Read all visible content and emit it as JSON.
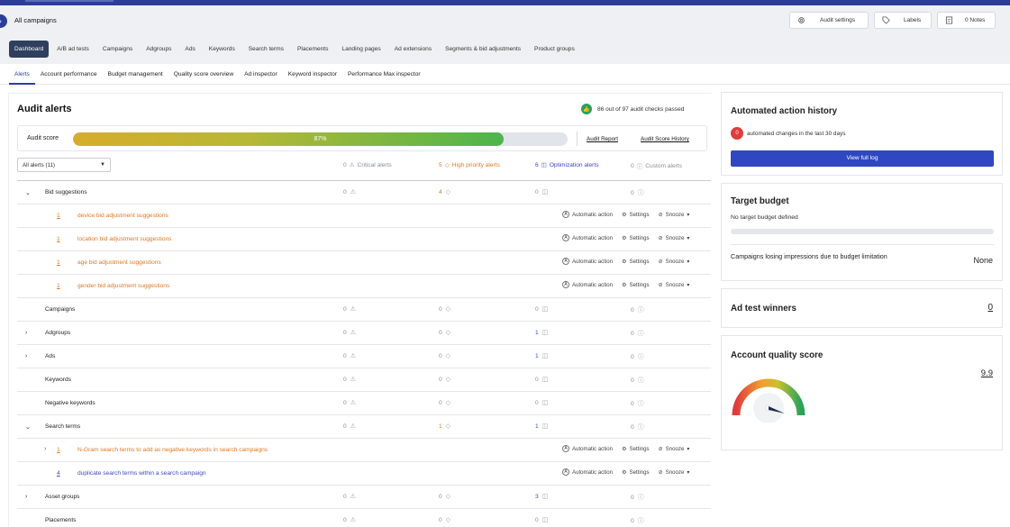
{
  "header": {
    "back_icon": "›",
    "breadcrumb": "All campaigns",
    "audit_settings_label": "Audit settings",
    "labels_label": "Labels",
    "notes_label": "0 Notes"
  },
  "nav1": {
    "items": [
      "Dashboard",
      "A/B ad tests",
      "Campaigns",
      "Adgroups",
      "Ads",
      "Keywords",
      "Search terms",
      "Placements",
      "Landing pages",
      "Ad extensions",
      "Segments & bid adjustments",
      "Product groups"
    ],
    "active_index": 0
  },
  "nav2": {
    "items": [
      "Alerts",
      "Account performance",
      "Budget management",
      "Quality score overview",
      "Ad inspector",
      "Keyword inspector",
      "Performance Max inspector"
    ],
    "active_index": 0
  },
  "audit": {
    "title": "Audit alerts",
    "passed_text": "86 out of 97 audit checks passed",
    "score_label": "Audit score",
    "score_percent": 87,
    "score_text": "87%",
    "report_link": "Audit Report",
    "history_link": "Audit Score History",
    "filter_value": "All alerts (11)",
    "critical": "0",
    "critical_label": "Critical alerts",
    "high": "5",
    "high_label": "High priority alerts",
    "optimization": "6",
    "optimization_label": "Optimization alerts",
    "custom": "0",
    "custom_label": "Custom alerts"
  },
  "actions": {
    "automatic": "Automatic action",
    "settings": "Settings",
    "snooze": "Snooze"
  },
  "rows": [
    {
      "type": "group",
      "tog": "⌄",
      "name": "Bid suggestions",
      "c1": "0",
      "c2": "4",
      "c2_color": "orange",
      "c3": "0",
      "c3_color": "gray",
      "c4": "0"
    },
    {
      "type": "sub",
      "cnt": "1",
      "name": "device bid adjustment suggestions",
      "color": "orange"
    },
    {
      "type": "sub",
      "cnt": "1",
      "name": "location bid adjustment suggestions",
      "color": "orange"
    },
    {
      "type": "sub",
      "cnt": "1",
      "name": "age bid adjustment suggestions",
      "color": "orange"
    },
    {
      "type": "sub",
      "cnt": "1",
      "name": "gender bid adjustment suggestions",
      "color": "orange"
    },
    {
      "type": "group",
      "tog": "",
      "name": "Campaigns",
      "c1": "0",
      "c2": "0",
      "c2_color": "gray",
      "c3": "0",
      "c3_color": "gray",
      "c4": "0"
    },
    {
      "type": "group",
      "tog": "›",
      "name": "Adgroups",
      "c1": "0",
      "c2": "0",
      "c2_color": "gray",
      "c3": "1",
      "c3_color": "blue",
      "c4": "0"
    },
    {
      "type": "group",
      "tog": "›",
      "name": "Ads",
      "c1": "0",
      "c2": "0",
      "c2_color": "gray",
      "c3": "1",
      "c3_color": "blue",
      "c4": "0"
    },
    {
      "type": "group",
      "tog": "",
      "name": "Keywords",
      "c1": "0",
      "c2": "0",
      "c2_color": "gray",
      "c3": "0",
      "c3_color": "gray",
      "c4": "0"
    },
    {
      "type": "group",
      "tog": "",
      "name": "Negative keywords",
      "c1": "0",
      "c2": "0",
      "c2_color": "gray",
      "c3": "0",
      "c3_color": "gray",
      "c4": "0"
    },
    {
      "type": "group",
      "tog": "⌄",
      "name": "Search terms",
      "c1": "0",
      "c2": "1",
      "c2_color": "orange",
      "c3": "1",
      "c3_color": "blue",
      "c4": "0"
    },
    {
      "type": "sub",
      "subtog": "›",
      "cnt": "1",
      "name": "N-Gram search terms to add as negative keywords in search campaigns",
      "color": "orange"
    },
    {
      "type": "sub",
      "cnt": "4",
      "name": "duplicate search terms within a search campaign",
      "color": "blue"
    },
    {
      "type": "group",
      "tog": "›",
      "name": "Asset groups",
      "c1": "0",
      "c2": "0",
      "c2_color": "gray",
      "c3": "3",
      "c3_color": "blue",
      "c4": "0"
    },
    {
      "type": "group",
      "tog": "",
      "name": "Placements",
      "c1": "0",
      "c2": "0",
      "c2_color": "gray",
      "c3": "0",
      "c3_color": "gray",
      "c4": "0"
    }
  ],
  "right": {
    "history_title": "Automated action history",
    "changes_count": "0",
    "changes_text": "automated changes in the last 30 days",
    "view_log": "View full log",
    "target_title": "Target budget",
    "target_text": "No target budget defined",
    "losing_label": "Campaigns losing impressions due to budget limitation",
    "losing_value": "None",
    "winners_title": "Ad test winners",
    "winners_value": "0",
    "quality_title": "Account quality score",
    "quality_value": "9.9",
    "quality_gauge_fraction": 0.9
  },
  "colors": {
    "brand": "#2b3e9a",
    "orange": "#e07822",
    "blue": "#3f46c6",
    "green": "#27a35a",
    "red": "#e03c3c"
  }
}
